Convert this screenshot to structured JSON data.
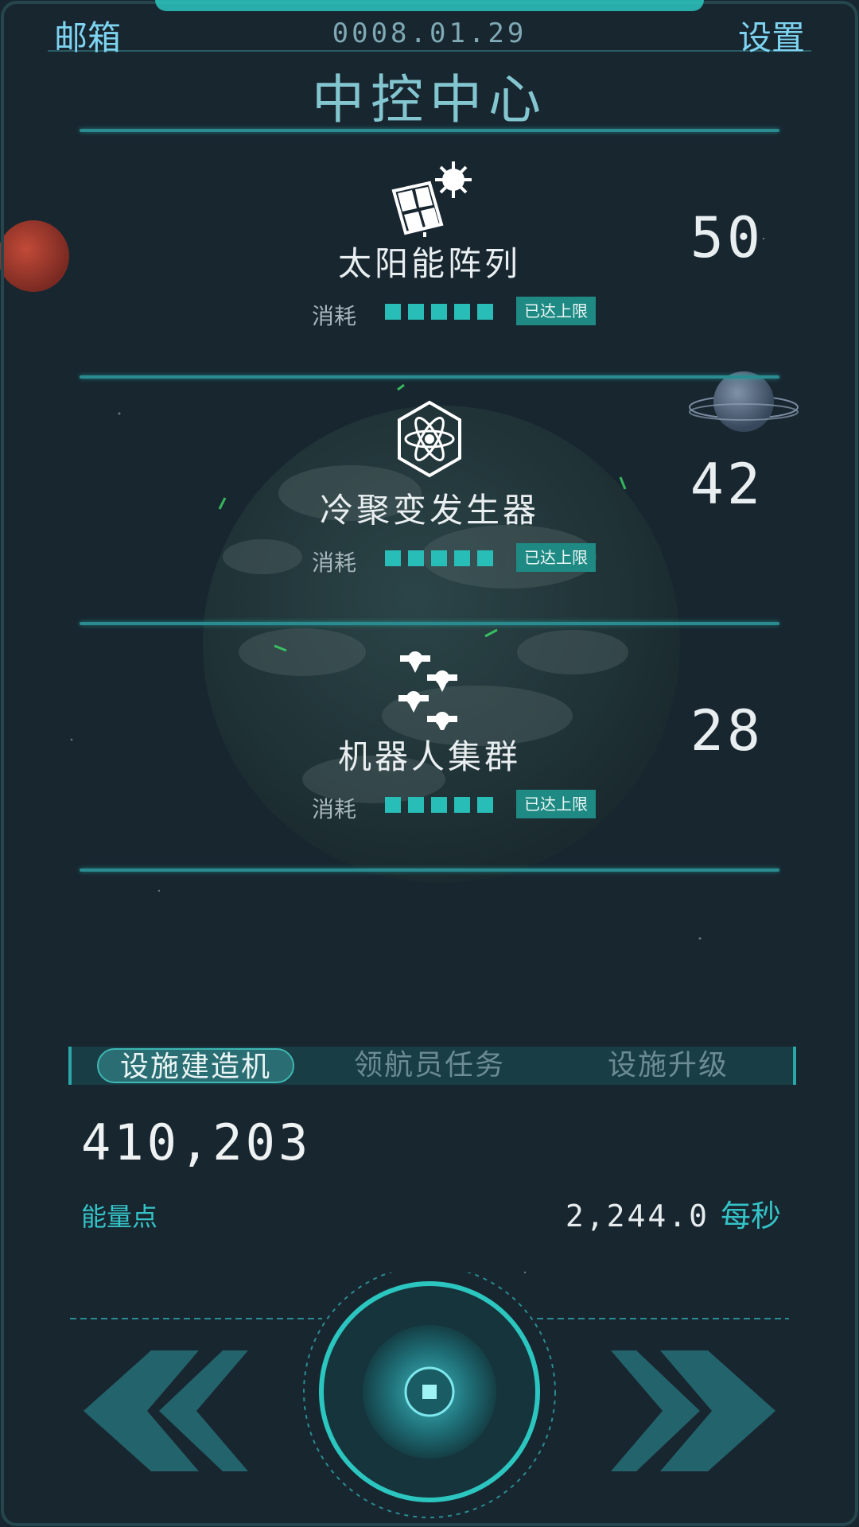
{
  "header": {
    "mail_label": "邮箱",
    "date": "0008.01.29",
    "settings_label": "设置",
    "title": "中控中心"
  },
  "facilities": [
    {
      "name": "太阳能阵列",
      "count": "50",
      "consume_label": "消耗",
      "consume_level": 5,
      "consume_max": 5,
      "badge": "已达上限",
      "icon": "solar-panel-icon"
    },
    {
      "name": "冷聚变发生器",
      "count": "42",
      "consume_label": "消耗",
      "consume_level": 5,
      "consume_max": 5,
      "badge": "已达上限",
      "icon": "atom-icon"
    },
    {
      "name": "机器人集群",
      "count": "28",
      "consume_label": "消耗",
      "consume_level": 5,
      "consume_max": 5,
      "badge": "已达上限",
      "icon": "robot-swarm-icon"
    }
  ],
  "tabs": [
    {
      "label": "设施建造机",
      "active": true
    },
    {
      "label": "领航员任务",
      "active": false
    },
    {
      "label": "设施升级",
      "active": false
    }
  ],
  "energy": {
    "value": "410,203",
    "label": "能量点",
    "rate": "2,244.0",
    "rate_unit": "每秒"
  },
  "colors": {
    "accent": "#2cc6c0",
    "background": "#182630",
    "label_cyan": "#34c3c6",
    "header_blue": "#7dd3f0"
  }
}
